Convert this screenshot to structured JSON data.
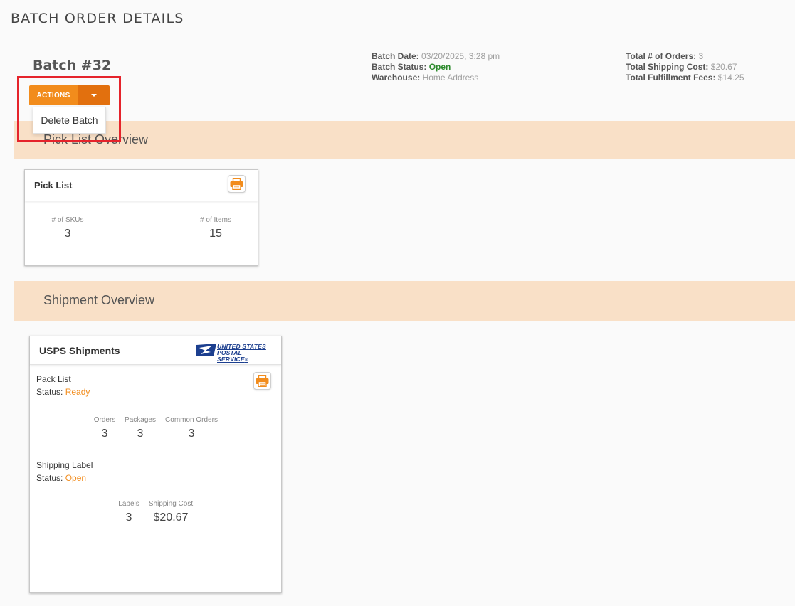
{
  "page": {
    "title": "BATCH ORDER DETAILS"
  },
  "batch": {
    "title": "Batch #32",
    "actions_label": "ACTIONS",
    "dropdown": {
      "items": [
        "Delete Batch"
      ]
    }
  },
  "meta": {
    "batch_date_label": "Batch Date:",
    "batch_date": "03/20/2025, 3:28 pm",
    "batch_status_label": "Batch Status:",
    "batch_status": "Open",
    "warehouse_label": "Warehouse:",
    "warehouse": "Home Address",
    "total_orders_label": "Total # of Orders:",
    "total_orders": "3",
    "total_shipping_label": "Total Shipping Cost:",
    "total_shipping": "$20.67",
    "total_fees_label": "Total Fulfillment Fees:",
    "total_fees": "$14.25"
  },
  "pick_section": {
    "band_title": "Pick List Overview",
    "card_title": "Pick List",
    "skus_label": "# of SKUs",
    "skus": "3",
    "items_label": "# of Items",
    "items": "15"
  },
  "ship_section": {
    "band_title": "Shipment Overview",
    "card_title": "USPS Shipments",
    "logo_line1": "UNITED STATES",
    "logo_line2": "POSTAL SERVICE",
    "logo_mark": "®",
    "pack_list": {
      "label": "Pack List",
      "status_label": "Status:",
      "status": "Ready",
      "orders_label": "Orders",
      "orders": "3",
      "packages_label": "Packages",
      "packages": "3",
      "common_label": "Common Orders",
      "common": "3"
    },
    "shipping_label": {
      "label": "Shipping Label",
      "status_label": "Status:",
      "status": "Open",
      "labels_label": "Labels",
      "labels": "3",
      "cost_label": "Shipping Cost",
      "cost": "$20.67"
    }
  },
  "colors": {
    "accent": "#f28c1c",
    "accent_dark": "#e2700e",
    "band": "#f9e0c7",
    "highlight": "#e5232b",
    "status_open_green": "#2e8b2e",
    "usps_blue": "#1c3f8f"
  }
}
